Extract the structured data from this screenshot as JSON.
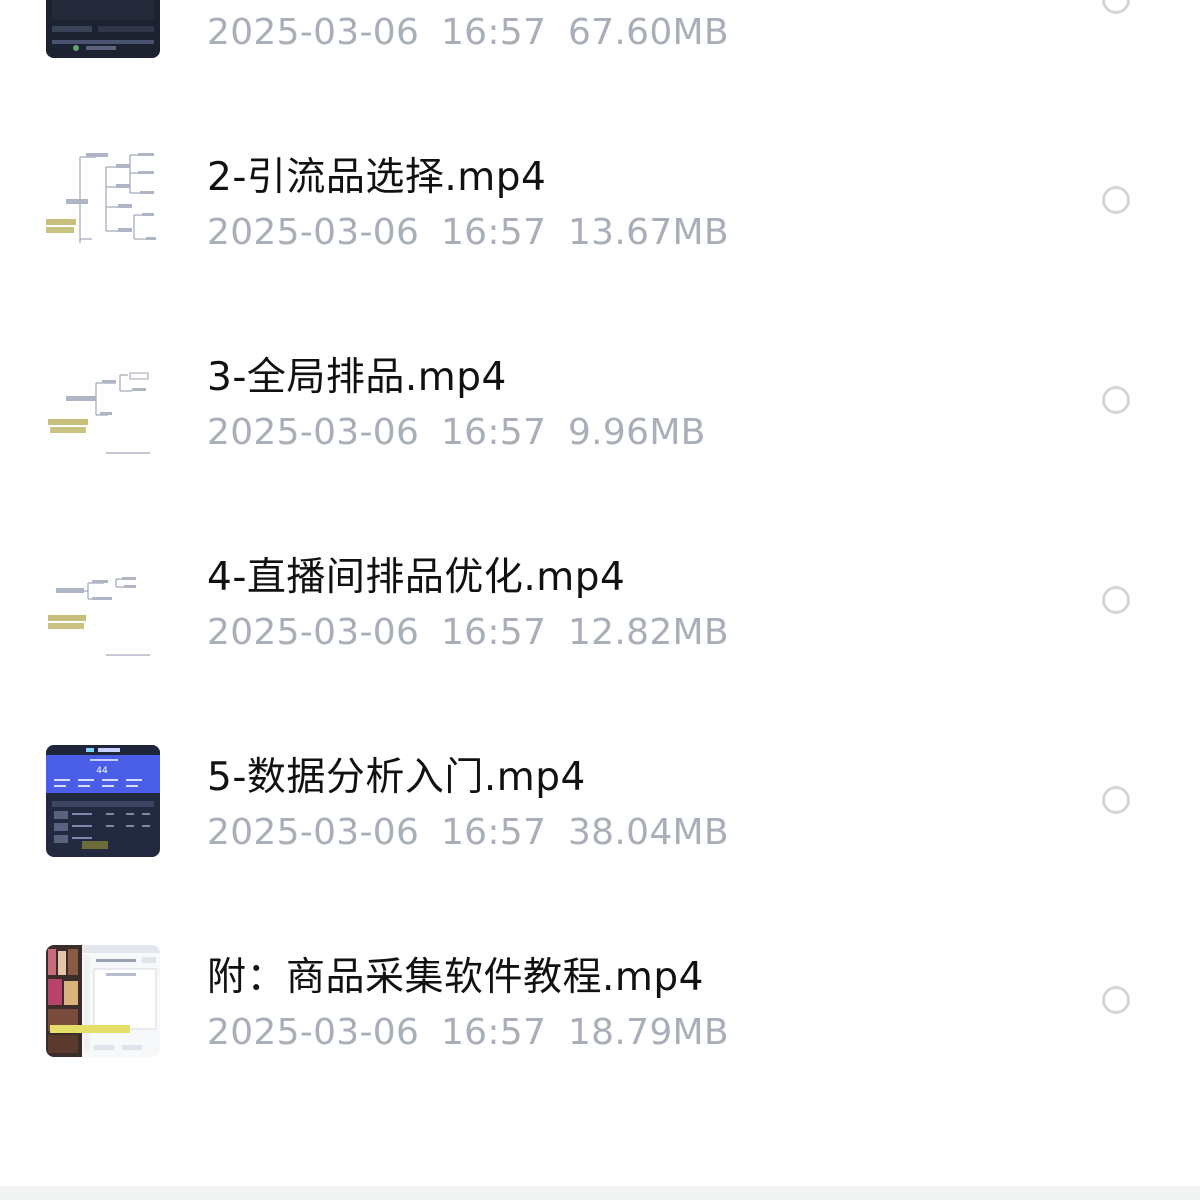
{
  "files": [
    {
      "name": "",
      "date": "2025-03-06",
      "time": "16:57",
      "size": "67.60MB",
      "thumbnail": "dark-screen-recording-thumbnail"
    },
    {
      "name": "2-引流品选择.mp4",
      "date": "2025-03-06",
      "time": "16:57",
      "size": "13.67MB",
      "thumbnail": "mindmap-thumbnail"
    },
    {
      "name": "3-全局排品.mp4",
      "date": "2025-03-06",
      "time": "16:57",
      "size": "9.96MB",
      "thumbnail": "mindmap-thumbnail"
    },
    {
      "name": "4-直播间排品优化.mp4",
      "date": "2025-03-06",
      "time": "16:57",
      "size": "12.82MB",
      "thumbnail": "mindmap-thumbnail"
    },
    {
      "name": "5-数据分析入门.mp4",
      "date": "2025-03-06",
      "time": "16:57",
      "size": "38.04MB",
      "thumbnail": "dashboard-thumbnail"
    },
    {
      "name": "附：商品采集软件教程.mp4",
      "date": "2025-03-06",
      "time": "16:57",
      "size": "18.79MB",
      "thumbnail": "software-tutorial-thumbnail"
    }
  ],
  "colors": {
    "name_text": "#111111",
    "meta_text": "#a9afb8",
    "radio_border": "#d4d6da",
    "dashboard_accent": "#4a5ee8"
  }
}
